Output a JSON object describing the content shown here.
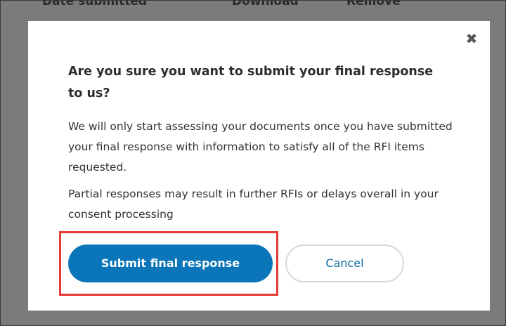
{
  "background": {
    "columns": [
      "Date submitted",
      "Download",
      "Remove"
    ]
  },
  "dialog": {
    "close_icon": "close-icon",
    "title": "Are you sure you want to submit your final response to us?",
    "paragraph1": "We will only start assessing your documents once you have submitted your final response with information to satisfy all of the RFI items requested.",
    "paragraph2": "Partial responses may result in further RFIs or delays overall in your consent processing",
    "submit_label": "Submit final response",
    "cancel_label": "Cancel"
  },
  "colors": {
    "primary": "#0a75b8",
    "highlight": "#e53935",
    "overlay": "#7b7b7b"
  }
}
